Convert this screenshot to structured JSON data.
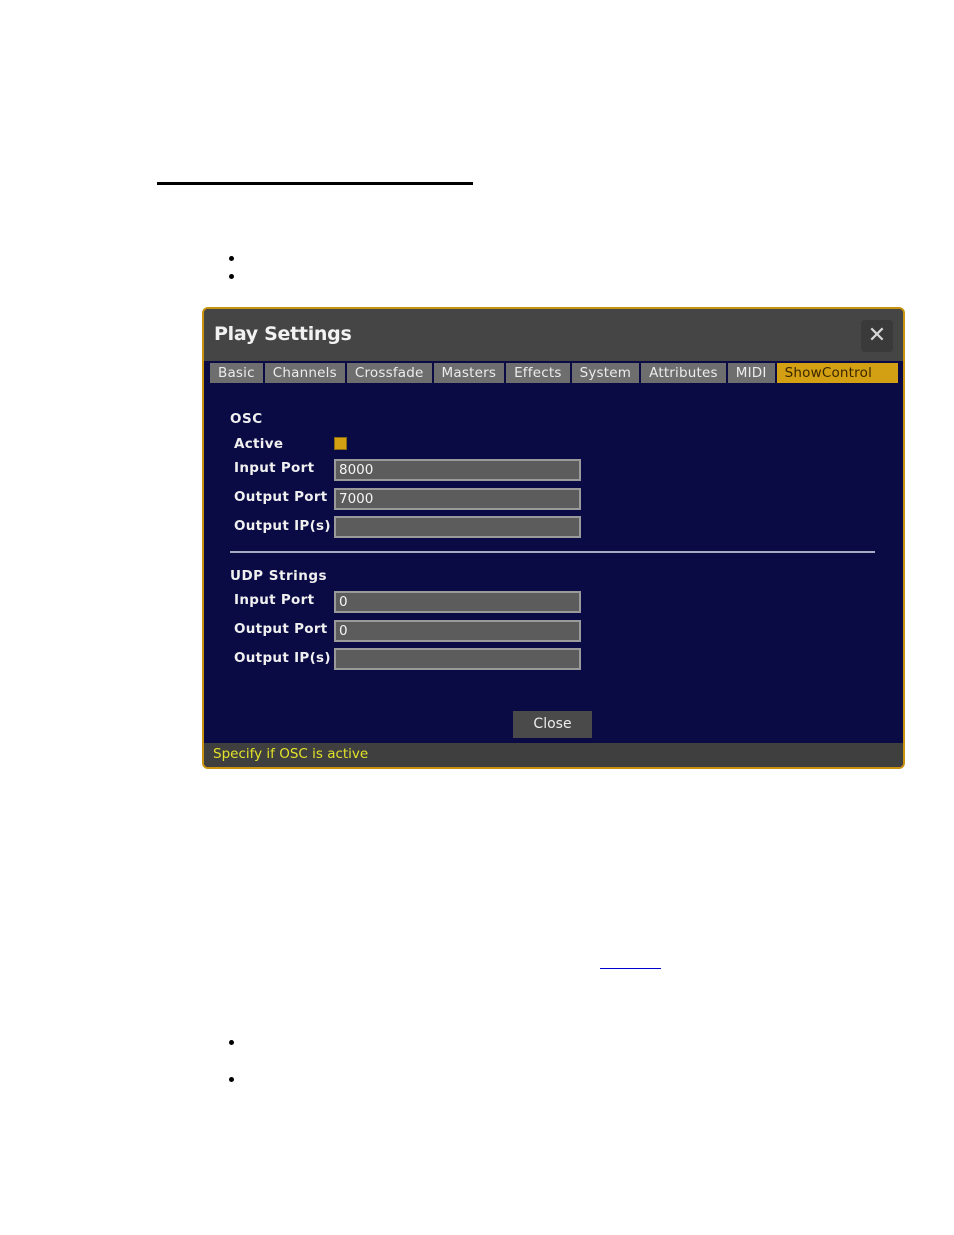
{
  "document": {
    "bullets_top_count": 2,
    "bullets_bottom_count": 2,
    "link_text": ""
  },
  "dialog": {
    "title": "Play Settings",
    "close_icon": "close-x-icon",
    "close_glyph": "✕",
    "tabs": [
      {
        "label": "Basic",
        "active": false
      },
      {
        "label": "Channels",
        "active": false
      },
      {
        "label": "Crossfade",
        "active": false
      },
      {
        "label": "Masters",
        "active": false
      },
      {
        "label": "Effects",
        "active": false
      },
      {
        "label": "System",
        "active": false
      },
      {
        "label": "Attributes",
        "active": false
      },
      {
        "label": "MIDI",
        "active": false
      },
      {
        "label": "ShowControl",
        "active": true
      }
    ],
    "osc": {
      "title": "OSC",
      "active_label": "Active",
      "active_checked": true,
      "input_port_label": "Input Port",
      "input_port_value": "8000",
      "output_port_label": "Output Port",
      "output_port_value": "7000",
      "output_ips_label": "Output IP(s)",
      "output_ips_value": ""
    },
    "udp": {
      "title": "UDP Strings",
      "input_port_label": "Input Port",
      "input_port_value": "0",
      "output_port_label": "Output Port",
      "output_port_value": "0",
      "output_ips_label": "Output IP(s)",
      "output_ips_value": ""
    },
    "close_button_label": "Close",
    "status_text": "Specify if OSC is active",
    "colors": {
      "accent": "#d4a013",
      "border": "#c8940f",
      "body_bg": "#0a0a45",
      "titlebar_bg": "#454545",
      "status_text": "#e3e32a"
    }
  }
}
